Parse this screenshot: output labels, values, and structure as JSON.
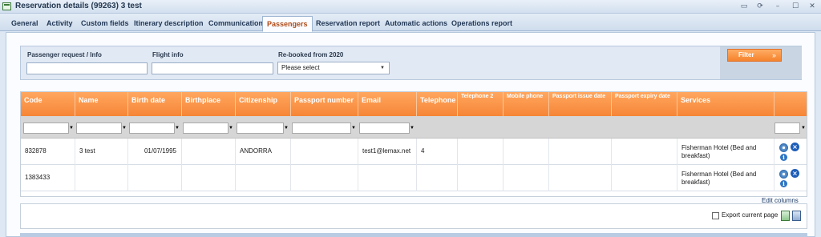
{
  "window": {
    "title": "Reservation details (99263) 3 test"
  },
  "tabs": [
    {
      "label": "General"
    },
    {
      "label": "Activity"
    },
    {
      "label": "Custom fields"
    },
    {
      "label": "Itinerary description"
    },
    {
      "label": "Communication"
    },
    {
      "label": "Passengers",
      "active": true
    },
    {
      "label": "Reservation report"
    },
    {
      "label": "Automatic actions"
    },
    {
      "label": "Operations report"
    }
  ],
  "filters": {
    "passenger_label": "Passenger request / Info",
    "passenger_value": "",
    "flight_label": "Flight info",
    "flight_value": "",
    "rebooked_label": "Re-booked from 2020",
    "rebooked_selected": "Please select",
    "filter_button": "Filter"
  },
  "grid": {
    "columns": [
      "Code",
      "Name",
      "Birth date",
      "Birthplace",
      "Citizenship",
      "Passport number",
      "Email",
      "Telephone",
      "Telephone 2",
      "Mobile phone",
      "Passport issue date",
      "Passport expiry date",
      "Services"
    ],
    "rows": [
      {
        "code": "832878",
        "name": "3 test",
        "birth_date": "01/07/1995",
        "birthplace": "",
        "citizenship": "ANDORRA",
        "passport_number": "",
        "email": "test1@lemax.net",
        "telephone": "4",
        "telephone2": "",
        "mobile": "",
        "passport_issue": "",
        "passport_expiry": "",
        "services": "Fisherman Hotel (Bed and breakfast)"
      },
      {
        "code": "1383433",
        "name": "",
        "birth_date": "",
        "birthplace": "",
        "citizenship": "",
        "passport_number": "",
        "email": "",
        "telephone": "",
        "telephone2": "",
        "mobile": "",
        "passport_issue": "",
        "passport_expiry": "",
        "services": "Fisherman Hotel (Bed and breakfast)"
      }
    ]
  },
  "footer": {
    "edit_columns": "Edit columns",
    "export_label": "Export current page"
  },
  "icons": {
    "window_controls": [
      "minimize-to-tray-icon",
      "refresh-icon",
      "minimize-icon",
      "maximize-icon",
      "close-icon"
    ],
    "row_actions": [
      "settings-gear-icon",
      "delete-icon",
      "info-icon"
    ],
    "export": [
      "excel-export-icon",
      "csv-export-icon"
    ]
  },
  "colors": {
    "header_orange": "#f68536",
    "active_tab_text": "#b04a16",
    "filter_button": "#f5832d"
  }
}
